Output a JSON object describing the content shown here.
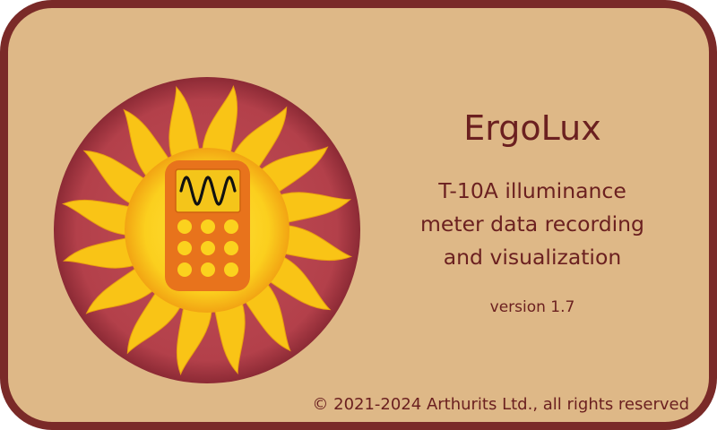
{
  "window": {
    "title": "ErgoLux"
  },
  "description": {
    "line1": "T-10A illuminance",
    "line2": "meter data recording",
    "line3": "and visualization"
  },
  "version": "version 1.7",
  "copyright": "© 2021-2024 Arthurits Ltd., all rights reserved",
  "logo": {
    "icons": [
      "sun-icon",
      "meter-device-icon",
      "waveform-icon"
    ]
  },
  "colors": {
    "frame": "#7a2a28",
    "background": "#deb887",
    "text": "#6b2020",
    "logo_circle": "#b3404a",
    "sun": "#f9c416",
    "device": "#e8731c"
  }
}
